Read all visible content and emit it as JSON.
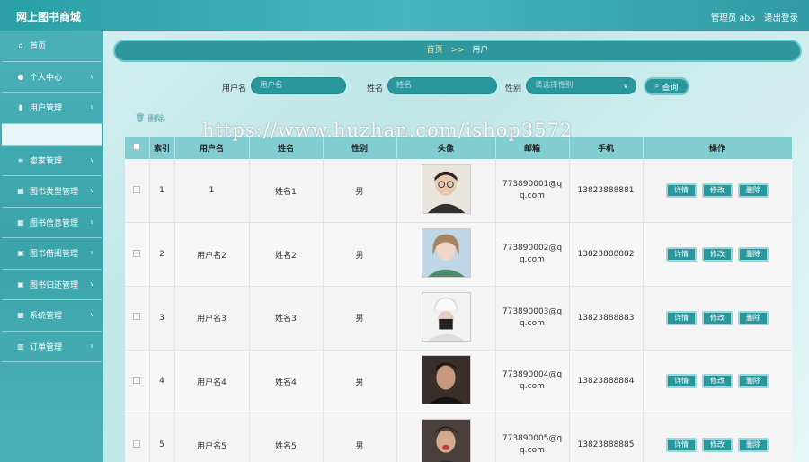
{
  "header": {
    "brand": "网上图书商城",
    "user": "管理员 abo",
    "logout": "退出登录"
  },
  "sidebar": {
    "items": [
      {
        "label": "首页",
        "icon": "home-icon",
        "glyph": "⌂",
        "chev": false
      },
      {
        "label": "个人中心",
        "icon": "user-icon",
        "glyph": "●",
        "chev": true
      },
      {
        "label": "用户管理",
        "icon": "chart-icon",
        "glyph": "▮",
        "chev": true
      },
      {
        "label": "卖家管理",
        "icon": "list-icon",
        "glyph": "≡",
        "chev": true
      },
      {
        "label": "图书类型管理",
        "icon": "grid-icon",
        "glyph": "▦",
        "chev": true
      },
      {
        "label": "图书信息管理",
        "icon": "grid-icon",
        "glyph": "▦",
        "chev": true
      },
      {
        "label": "图书借阅管理",
        "icon": "image-icon",
        "glyph": "▣",
        "chev": true
      },
      {
        "label": "图书归还管理",
        "icon": "image-icon",
        "glyph": "▣",
        "chev": true
      },
      {
        "label": "系统管理",
        "icon": "grid-icon",
        "glyph": "▦",
        "chev": true
      },
      {
        "label": "订单管理",
        "icon": "table-icon",
        "glyph": "▥",
        "chev": true
      }
    ]
  },
  "breadcrumb": {
    "home": "首页",
    "sep": ">>",
    "current": "用户"
  },
  "search": {
    "username_label": "用户名",
    "username_placeholder": "用户名",
    "name_label": "姓名",
    "name_placeholder": "姓名",
    "gender_label": "性别",
    "gender_placeholder": "请选择性别",
    "query_label": "查询"
  },
  "toolbar": {
    "delete_label": "删除"
  },
  "watermark": "https://www.huzhan.com/ishop3572",
  "table": {
    "headers": [
      "",
      "索引",
      "用户名",
      "姓名",
      "性别",
      "头像",
      "邮箱",
      "手机",
      "操作"
    ],
    "rows": [
      {
        "index": "1",
        "username": "1",
        "name": "姓名1",
        "gender": "男",
        "email": "773890001@qq.com",
        "phone": "13823888881"
      },
      {
        "index": "2",
        "username": "用户名2",
        "name": "姓名2",
        "gender": "男",
        "email": "773890002@qq.com",
        "phone": "13823888882"
      },
      {
        "index": "3",
        "username": "用户名3",
        "name": "姓名3",
        "gender": "男",
        "email": "773890003@qq.com",
        "phone": "13823888883"
      },
      {
        "index": "4",
        "username": "用户名4",
        "name": "姓名4",
        "gender": "男",
        "email": "773890004@qq.com",
        "phone": "13823888884"
      },
      {
        "index": "5",
        "username": "用户名5",
        "name": "姓名5",
        "gender": "男",
        "email": "773890005@qq.com",
        "phone": "13823888885"
      }
    ],
    "ops": {
      "detail": "详情",
      "edit": "修改",
      "delete": "删除"
    }
  },
  "colors": {
    "accent": "#2a979d",
    "header_bg": "#82cdd2",
    "sidebar": "#3aa4aa"
  }
}
